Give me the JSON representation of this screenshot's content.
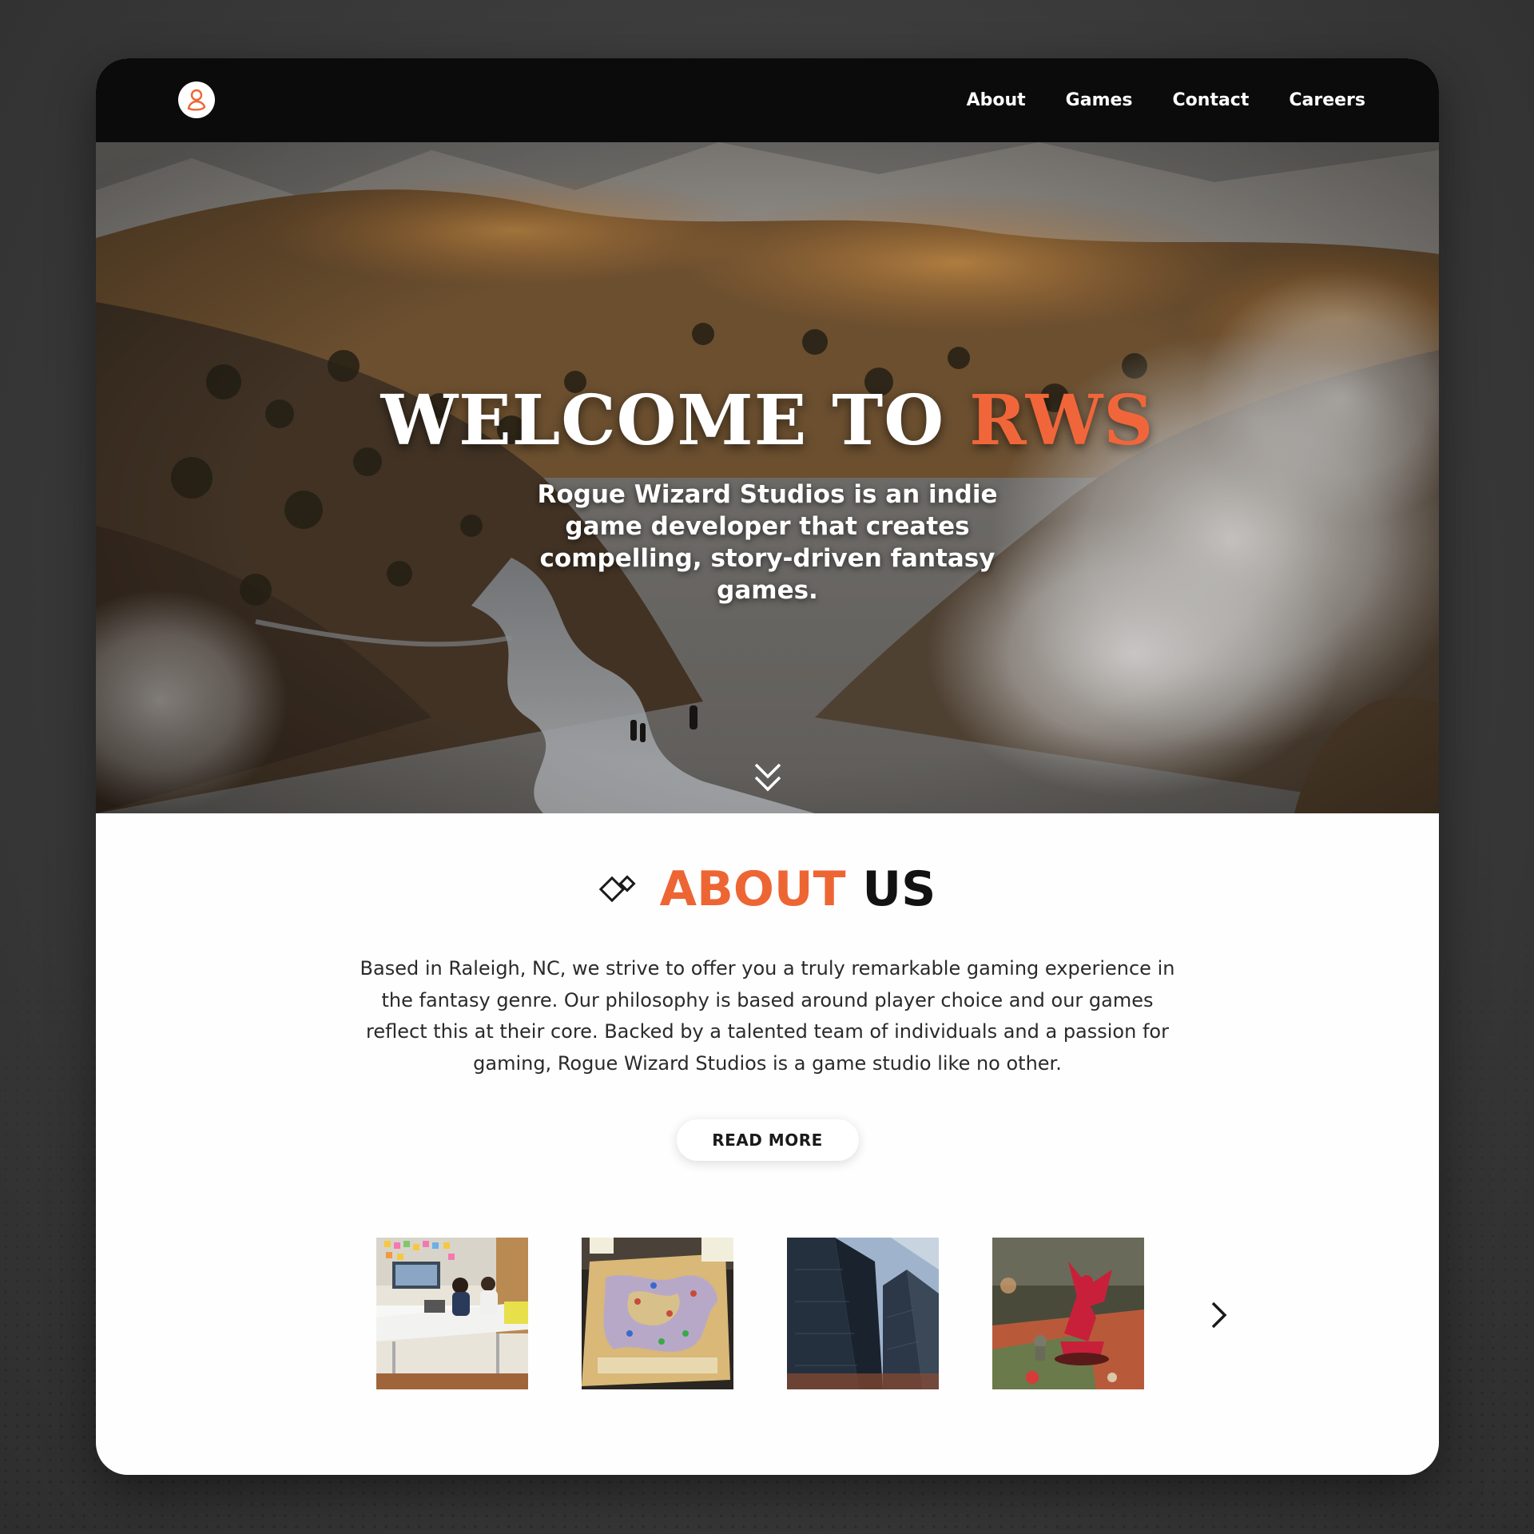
{
  "nav": {
    "logo_icon": "user-icon",
    "links": [
      "About",
      "Games",
      "Contact",
      "Careers"
    ]
  },
  "hero": {
    "title_main": "WELCOME TO",
    "title_accent": "RWS",
    "subtitle": "Rogue Wizard Studios is an indie game developer that creates compelling, story-driven fantasy games.",
    "scroll_icon": "double-chevron-down-icon"
  },
  "about": {
    "heading_accent": "ABOUT",
    "heading_rest": "US",
    "heading_icon": "diamond-pair-icon",
    "body": "Based in Raleigh, NC, we strive to offer you a truly remarkable gaming experience in the fantasy genre. Our philosophy is based around player choice and our games reflect this at their core. Backed by a talented team of individuals and a passion for gaming, Rogue Wizard Studios is a game studio like no other.",
    "button_label": "READ MORE"
  },
  "gallery": {
    "next_icon": "chevron-right-icon"
  },
  "colors": {
    "accent": "#ee6534",
    "nav_bg": "#0b0b0b",
    "page_bg": "#fefefe"
  }
}
